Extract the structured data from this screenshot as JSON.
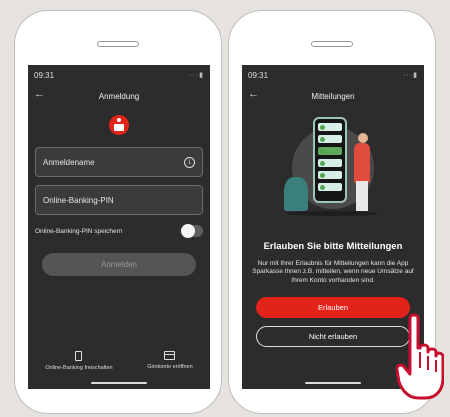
{
  "login_screen": {
    "status_time": "09:31",
    "title": "Anmeldung",
    "username_field": "Anmeldename",
    "pin_field": "Online-Banking-PIN",
    "save_pin_label": "Online-Banking-PIN speichern",
    "login_button": "Anmelden",
    "links": [
      {
        "label": "Online-Banking freischalten",
        "icon": "smartphone-icon"
      },
      {
        "label": "Girokonto eröffnen",
        "icon": "card-icon"
      }
    ]
  },
  "notifications_screen": {
    "status_time": "09:31",
    "title": "Mitteilungen",
    "heading": "Erlauben Sie bitte Mitteilungen",
    "description": "Nur mit Ihrer Erlaubnis für Mitteilungen kann die App Sparkasse Ihnen z.B. mitteilen, wenn neue Umsätze auf Ihrem Konto vorhanden sind.",
    "allow_button": "Erlauben",
    "deny_button": "Nicht erlauben"
  },
  "colors": {
    "accent": "#e2231a",
    "screen_bg": "#2c2c2c",
    "page_bg": "#e6e3df"
  }
}
